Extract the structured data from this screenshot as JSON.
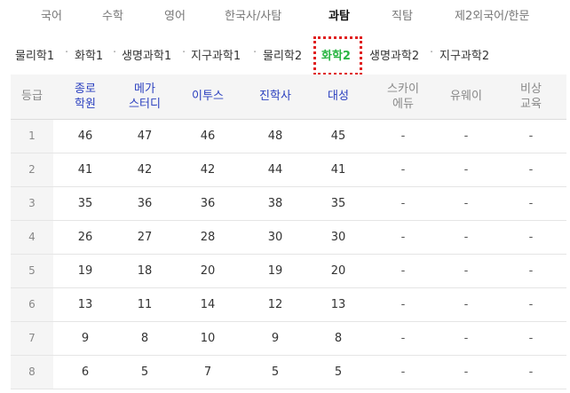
{
  "top_tabs": [
    "국어",
    "수학",
    "영어",
    "한국사/사탐",
    "과탐",
    "직탐",
    "제2외국어/한문"
  ],
  "top_tab_active": "과탐",
  "sub_tabs": [
    "물리학1",
    "화학1",
    "생명과학1",
    "지구과학1",
    "물리학2",
    "화학2",
    "생명과학2",
    "지구과학2"
  ],
  "sub_tab_active": "화학2",
  "separator": "·",
  "table": {
    "headers": [
      "등급",
      "종로\n학원",
      "메가\n스터디",
      "이투스",
      "진학사",
      "대성",
      "스카이\n에듀",
      "유웨이",
      "비상\n교육"
    ],
    "rows": [
      [
        "1",
        "46",
        "47",
        "46",
        "48",
        "45",
        "-",
        "-",
        "-"
      ],
      [
        "2",
        "41",
        "42",
        "42",
        "44",
        "41",
        "-",
        "-",
        "-"
      ],
      [
        "3",
        "35",
        "36",
        "36",
        "38",
        "35",
        "-",
        "-",
        "-"
      ],
      [
        "4",
        "26",
        "27",
        "28",
        "30",
        "30",
        "-",
        "-",
        "-"
      ],
      [
        "5",
        "19",
        "18",
        "20",
        "19",
        "20",
        "-",
        "-",
        "-"
      ],
      [
        "6",
        "13",
        "11",
        "14",
        "12",
        "13",
        "-",
        "-",
        "-"
      ],
      [
        "7",
        "9",
        "8",
        "10",
        "9",
        "8",
        "-",
        "-",
        "-"
      ],
      [
        "8",
        "6",
        "5",
        "7",
        "5",
        "5",
        "-",
        "-",
        "-"
      ]
    ]
  },
  "colors": {
    "active_subtab": "#2ab543",
    "provider_header": "#2a3fbf",
    "highlight_border": "#e02020"
  }
}
